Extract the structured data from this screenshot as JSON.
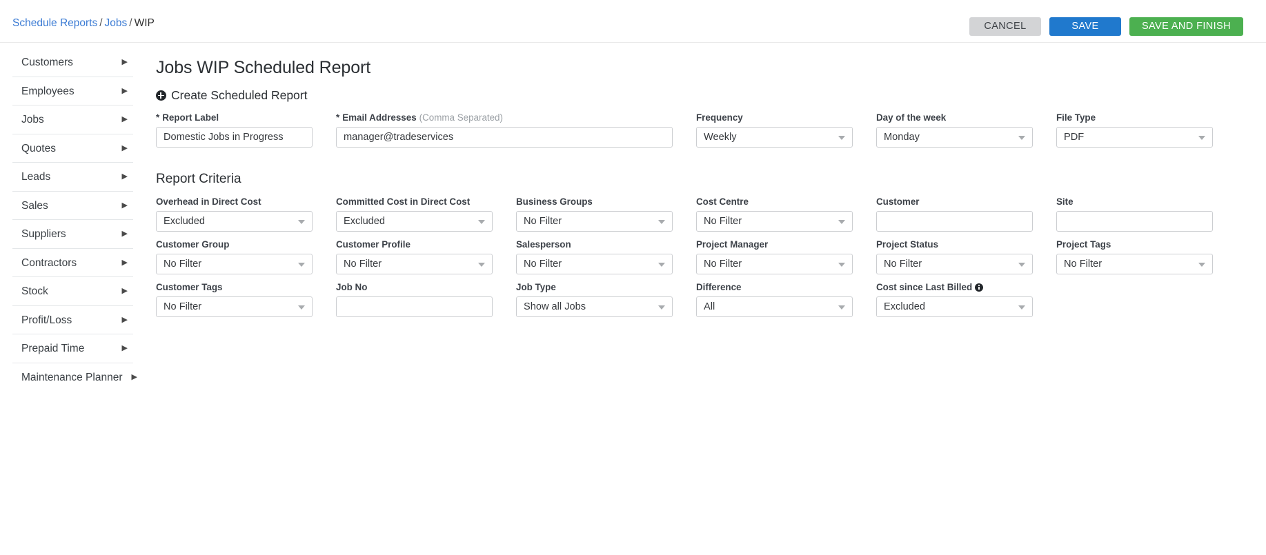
{
  "breadcrumb": {
    "items": [
      {
        "label": "Schedule Reports",
        "link": true
      },
      {
        "label": "Jobs",
        "link": true
      },
      {
        "label": "WIP",
        "link": false
      }
    ],
    "separator": "/"
  },
  "toolbar": {
    "cancel_label": "CANCEL",
    "save_label": "SAVE",
    "save_finish_label": "SAVE AND FINISH",
    "colors": {
      "cancel_bg": "#d3d4d6",
      "save_bg": "#2079cd",
      "save_finish_bg": "#4cb050",
      "link": "#3b7bd4"
    }
  },
  "sidebar": {
    "items": [
      {
        "label": "Customers"
      },
      {
        "label": "Employees"
      },
      {
        "label": "Jobs"
      },
      {
        "label": "Quotes"
      },
      {
        "label": "Leads"
      },
      {
        "label": "Sales"
      },
      {
        "label": "Suppliers"
      },
      {
        "label": "Contractors"
      },
      {
        "label": "Stock"
      },
      {
        "label": "Profit/Loss"
      },
      {
        "label": "Prepaid Time"
      },
      {
        "label": "Maintenance Planner"
      }
    ],
    "caret_glyph": "▶"
  },
  "main": {
    "page_title": "Jobs WIP Scheduled Report",
    "create_label": "Create Scheduled Report",
    "section_title": "Report Criteria"
  },
  "schedule": {
    "report_label": {
      "label": "Report Label",
      "required_mark": "*",
      "value": "Domestic Jobs in Progress"
    },
    "email_addresses": {
      "label": "Email Addresses",
      "required_mark": "*",
      "hint": "(Comma Separated)",
      "value": "manager@tradeservices"
    },
    "frequency": {
      "label": "Frequency",
      "value": "Weekly"
    },
    "day_of_week": {
      "label": "Day of the week",
      "value": "Monday"
    },
    "file_type": {
      "label": "File Type",
      "value": "PDF"
    }
  },
  "criteria": {
    "overhead_in_direct_cost": {
      "label": "Overhead in Direct Cost",
      "value": "Excluded"
    },
    "committed_cost_in_direct_cost": {
      "label": "Committed Cost in Direct Cost",
      "value": "Excluded"
    },
    "business_groups": {
      "label": "Business Groups",
      "value": "No Filter"
    },
    "cost_centre": {
      "label": "Cost Centre",
      "value": "No Filter"
    },
    "customer": {
      "label": "Customer",
      "value": ""
    },
    "site": {
      "label": "Site",
      "value": ""
    },
    "customer_group": {
      "label": "Customer Group",
      "value": "No Filter"
    },
    "customer_profile": {
      "label": "Customer Profile",
      "value": "No Filter"
    },
    "salesperson": {
      "label": "Salesperson",
      "value": "No Filter"
    },
    "project_manager": {
      "label": "Project Manager",
      "value": "No Filter"
    },
    "project_status": {
      "label": "Project Status",
      "value": "No Filter"
    },
    "project_tags": {
      "label": "Project Tags",
      "value": "No Filter"
    },
    "customer_tags": {
      "label": "Customer Tags",
      "value": "No Filter"
    },
    "job_no": {
      "label": "Job No",
      "value": ""
    },
    "job_type": {
      "label": "Job Type",
      "value": "Show all Jobs"
    },
    "difference": {
      "label": "Difference",
      "value": "All"
    },
    "cost_since_last_billed": {
      "label": "Cost since Last Billed",
      "value": "Excluded",
      "has_info_icon": true
    }
  }
}
